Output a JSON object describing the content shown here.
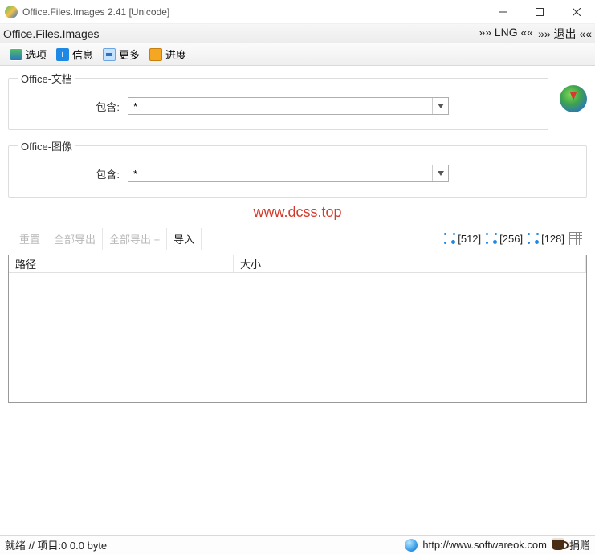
{
  "titlebar": {
    "title": "Office.Files.Images 2.41 [Unicode]"
  },
  "menubar": {
    "app_name": "Office.Files.Images",
    "lng": "»»  LNG  ««",
    "exit": "»»  退出  ««"
  },
  "toolbar": {
    "options": "选项",
    "info": "信息",
    "more": "更多",
    "progress": "进度"
  },
  "groups": {
    "docs": {
      "legend": "Office-文档",
      "include_label": "包含:",
      "include_value": "*"
    },
    "images": {
      "legend": "Office-图像",
      "include_label": "包含:",
      "include_value": "*"
    }
  },
  "watermark": "www.dcss.top",
  "actions": {
    "reset": "重置",
    "export_all": "全部导出",
    "export_all_plus": "全部导出 +",
    "import": "导入",
    "size512": "[512]",
    "size256": "[256]",
    "size128": "[128]"
  },
  "table": {
    "col_path": "路径",
    "col_size": "大小"
  },
  "status": {
    "left": "就绪 // 项目:0 0.0 byte",
    "url": "http://www.softwareok.com",
    "donate": "捐赠"
  }
}
